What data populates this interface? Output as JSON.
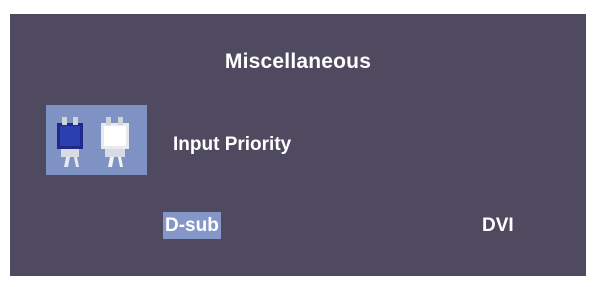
{
  "menu": {
    "title": "Miscellaneous",
    "item_label": "Input Priority",
    "item_icon": "input-connectors-icon",
    "options": [
      {
        "label": "D-sub",
        "selected": true
      },
      {
        "label": "DVI",
        "selected": false
      }
    ]
  },
  "colors": {
    "panel_background": "#4f4a5f",
    "icon_background": "#7e92c4",
    "selection_highlight": "#8596c8",
    "text": "#ffffff"
  }
}
